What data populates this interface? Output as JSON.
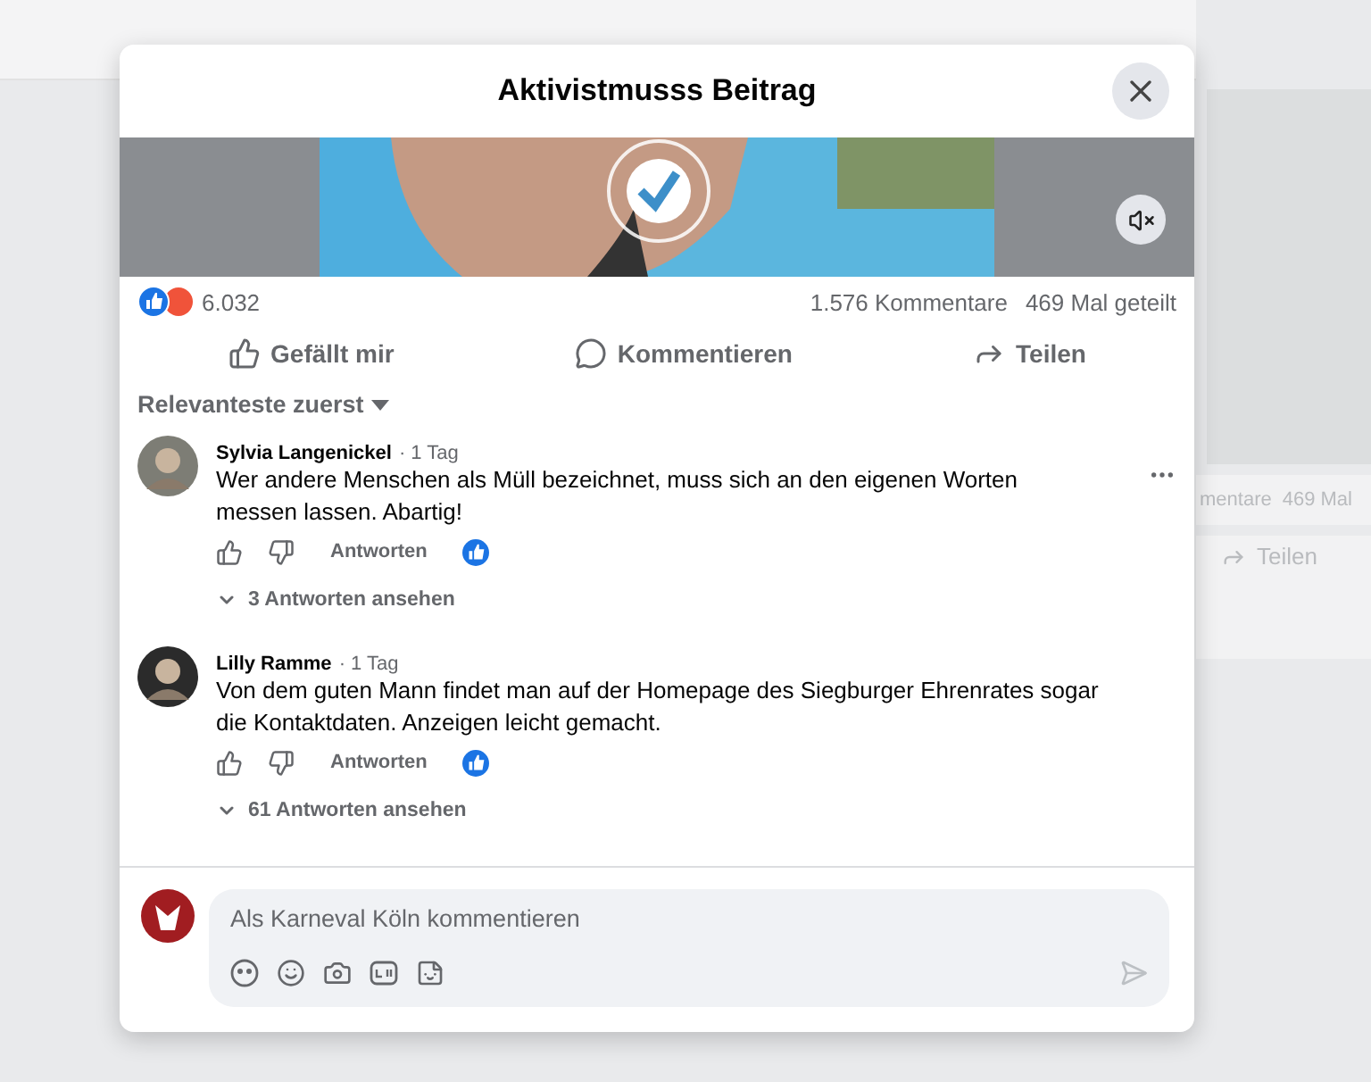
{
  "background": {
    "stats_fragment": "mentare",
    "shares_fragment": "469 Mal",
    "share_label": "Teilen"
  },
  "dialog": {
    "title": "Aktivistmusss Beitrag",
    "muted": true
  },
  "stats": {
    "reactions": "6.032",
    "comments": "1.576 Kommentare",
    "shares": "469 Mal geteilt"
  },
  "actions": [
    "Gefällt mir",
    "Kommentieren",
    "Teilen"
  ],
  "sort": "Relevanteste zuerst",
  "comments": [
    {
      "author": "Sylvia Langenickel",
      "time": "· 1 Tag",
      "text": "Wer andere Menschen als Müll bezeichnet, muss sich an den eigenen Worten messen lassen. Abartig!",
      "reply": "Antworten",
      "replies": "3 Antworten ansehen",
      "menu": true
    },
    {
      "author": "Lilly Ramme",
      "time": "· 1 Tag",
      "text": "Von dem guten Mann findet man auf der Homepage des Siegburger Ehrenrates sogar die Kontaktdaten. Anzeigen leicht gemacht.",
      "reply": "Antworten",
      "replies": "61 Antworten ansehen",
      "menu": false
    }
  ],
  "composer": {
    "placeholder": "Als Karneval Köln kommentieren"
  }
}
